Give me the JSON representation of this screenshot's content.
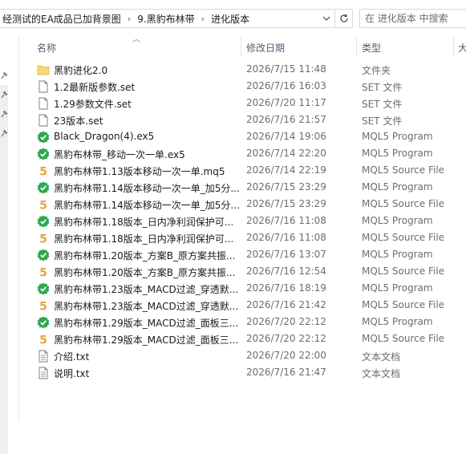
{
  "address": {
    "crumbs": [
      "经测试的EA成品已加背景图",
      "9.黑豹布林带",
      "进化版本"
    ],
    "search_placeholder": "在 进化版本 中搜索"
  },
  "columns": {
    "name": "名称",
    "date": "修改日期",
    "type": "类型",
    "size": "大"
  },
  "files": [
    {
      "name": "黑豹进化2.0",
      "date": "2026/7/15 11:48",
      "type": "文件夹",
      "icon": "folder-icon"
    },
    {
      "name": "1.2最新版参数.set",
      "date": "2026/7/16 16:03",
      "type": "SET 文件",
      "icon": "document-icon"
    },
    {
      "name": "1.29参数文件.set",
      "date": "2026/7/20 11:17",
      "type": "SET 文件",
      "icon": "document-icon"
    },
    {
      "name": "23版本.set",
      "date": "2026/7/16 21:57",
      "type": "SET 文件",
      "icon": "document-icon"
    },
    {
      "name": "Black_Dragon(4).ex5",
      "date": "2026/7/14 19:06",
      "type": "MQL5 Program",
      "icon": "mql5-program-icon"
    },
    {
      "name": "黑豹布林带_移动一次一单.ex5",
      "date": "2026/7/14 22:20",
      "type": "MQL5 Program",
      "icon": "mql5-program-icon"
    },
    {
      "name": "黑豹布林带1.13版本移动一次一单.mq5",
      "date": "2026/7/14 22:19",
      "type": "MQL5 Source File",
      "icon": "mql5-source-icon"
    },
    {
      "name": "黑豹布林带1.14版本移动一次一单_加5分...",
      "date": "2026/7/15 23:29",
      "type": "MQL5 Program",
      "icon": "mql5-program-icon"
    },
    {
      "name": "黑豹布林带1.14版本移动一次一单_加5分...",
      "date": "2026/7/15 23:29",
      "type": "MQL5 Source File",
      "icon": "mql5-source-icon"
    },
    {
      "name": "黑豹布林带1.18版本_日内净利润保护可...",
      "date": "2026/7/16 11:08",
      "type": "MQL5 Program",
      "icon": "mql5-program-icon"
    },
    {
      "name": "黑豹布林带1.18版本_日内净利润保护可...",
      "date": "2026/7/16 11:08",
      "type": "MQL5 Source File",
      "icon": "mql5-source-icon"
    },
    {
      "name": "黑豹布林带1.20版本_方案B_原方案共振...",
      "date": "2026/7/16 13:07",
      "type": "MQL5 Program",
      "icon": "mql5-program-icon"
    },
    {
      "name": "黑豹布林带1.20版本_方案B_原方案共振...",
      "date": "2026/7/16 12:54",
      "type": "MQL5 Source File",
      "icon": "mql5-source-icon"
    },
    {
      "name": "黑豹布林带1.23版本_MACD过滤_穿透默...",
      "date": "2026/7/16 18:19",
      "type": "MQL5 Program",
      "icon": "mql5-program-icon"
    },
    {
      "name": "黑豹布林带1.23版本_MACD过滤_穿透默...",
      "date": "2026/7/16 21:42",
      "type": "MQL5 Source File",
      "icon": "mql5-source-icon"
    },
    {
      "name": "黑豹布林带1.29版本_MACD过滤_面板三...",
      "date": "2026/7/20 22:12",
      "type": "MQL5 Program",
      "icon": "mql5-program-icon"
    },
    {
      "name": "黑豹布林带1.29版本_MACD过滤_面板三...",
      "date": "2026/7/20 22:12",
      "type": "MQL5 Source File",
      "icon": "mql5-source-icon"
    },
    {
      "name": "介绍.txt",
      "date": "2026/7/20 22:00",
      "type": "文本文档",
      "icon": "text-document-icon"
    },
    {
      "name": "说明.txt",
      "date": "2026/7/16 21:47",
      "type": "文本文档",
      "icon": "text-document-icon"
    }
  ],
  "colors": {
    "folder": "#f8d775",
    "mql5_program": "#2fa84f",
    "mql5_source": "#e8a33d",
    "header_text": "#4c607a"
  }
}
